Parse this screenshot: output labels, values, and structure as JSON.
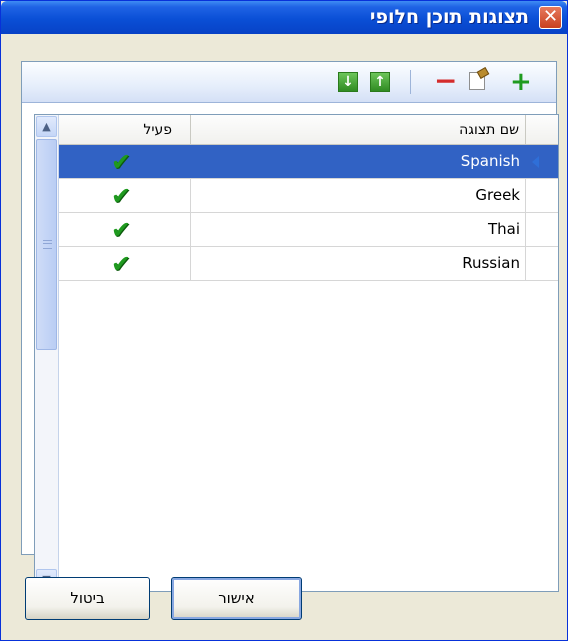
{
  "window": {
    "title": "תצוגות תוכן חלופי",
    "close_label": "✕"
  },
  "toolbar": {
    "icons": [
      "down-arrow-icon",
      "up-arrow-icon",
      "minus-icon",
      "edit-icon",
      "plus-icon"
    ],
    "down_glyph": "↓",
    "up_glyph": "↑",
    "remove_glyph": "−",
    "add_glyph": "+"
  },
  "grid": {
    "columns": {
      "active": "פעיל",
      "name": "שם תצוגה"
    },
    "rows": [
      {
        "name": "Spanish",
        "active": "✔",
        "selected": true
      },
      {
        "name": "Greek",
        "active": "✔",
        "selected": false
      },
      {
        "name": "Thai",
        "active": "✔",
        "selected": false
      },
      {
        "name": "Russian",
        "active": "✔",
        "selected": false
      }
    ],
    "scroll_up_glyph": "▲",
    "scroll_down_glyph": "▼"
  },
  "buttons": {
    "cancel": "ביטול",
    "ok": "אישור"
  },
  "colors": {
    "title_bar": "#0a4fd6",
    "selection": "#3162c4",
    "check": "#1f9a1f"
  }
}
